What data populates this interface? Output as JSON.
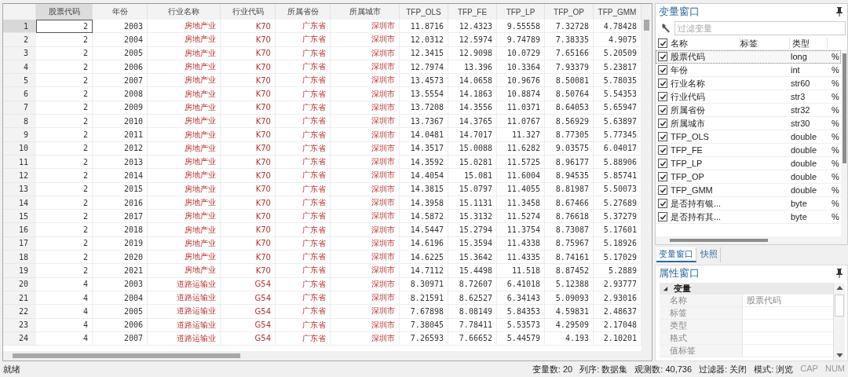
{
  "table": {
    "columns": [
      {
        "label": "股票代码",
        "kind": "numeric"
      },
      {
        "label": "年份",
        "kind": "numeric"
      },
      {
        "label": "行业名称",
        "kind": "string"
      },
      {
        "label": "行业代码",
        "kind": "string"
      },
      {
        "label": "所属省份",
        "kind": "string"
      },
      {
        "label": "所属城市",
        "kind": "string"
      },
      {
        "label": "TFP_OLS",
        "kind": "numeric"
      },
      {
        "label": "TFP_FE",
        "kind": "numeric"
      },
      {
        "label": "TFP_LP",
        "kind": "numeric"
      },
      {
        "label": "TFP_OP",
        "kind": "numeric"
      },
      {
        "label": "TFP_GMM",
        "kind": "numeric"
      }
    ],
    "rows": [
      {
        "number": "1",
        "selected": true,
        "cells": [
          "2",
          "2003",
          "房地产业",
          "K70",
          "广东省",
          "深圳市",
          "11.8716",
          "12.4323",
          "9.55558",
          "7.32728",
          "4.78428"
        ]
      },
      {
        "number": "2",
        "selected": false,
        "cells": [
          "2",
          "2004",
          "房地产业",
          "K70",
          "广东省",
          "深圳市",
          "12.0312",
          "12.5974",
          "9.74789",
          "7.38335",
          "4.9075"
        ]
      },
      {
        "number": "3",
        "selected": false,
        "cells": [
          "2",
          "2005",
          "房地产业",
          "K70",
          "广东省",
          "深圳市",
          "12.3415",
          "12.9098",
          "10.0729",
          "7.65166",
          "5.20509"
        ]
      },
      {
        "number": "4",
        "selected": false,
        "cells": [
          "2",
          "2006",
          "房地产业",
          "K70",
          "广东省",
          "深圳市",
          "12.7974",
          "13.396",
          "10.3364",
          "7.93379",
          "5.23817"
        ]
      },
      {
        "number": "5",
        "selected": false,
        "cells": [
          "2",
          "2007",
          "房地产业",
          "K70",
          "广东省",
          "深圳市",
          "13.4573",
          "14.0658",
          "10.9676",
          "8.50081",
          "5.78035"
        ]
      },
      {
        "number": "6",
        "selected": false,
        "cells": [
          "2",
          "2008",
          "房地产业",
          "K70",
          "广东省",
          "深圳市",
          "13.5554",
          "14.1863",
          "10.8874",
          "8.50764",
          "5.54353"
        ]
      },
      {
        "number": "7",
        "selected": false,
        "cells": [
          "2",
          "2009",
          "房地产业",
          "K70",
          "广东省",
          "深圳市",
          "13.7208",
          "14.3556",
          "11.0371",
          "8.64053",
          "5.65947"
        ]
      },
      {
        "number": "8",
        "selected": false,
        "cells": [
          "2",
          "2010",
          "房地产业",
          "K70",
          "广东省",
          "深圳市",
          "13.7367",
          "14.3765",
          "11.0767",
          "8.56929",
          "5.63897"
        ]
      },
      {
        "number": "9",
        "selected": false,
        "cells": [
          "2",
          "2011",
          "房地产业",
          "K70",
          "广东省",
          "深圳市",
          "14.0481",
          "14.7017",
          "11.327",
          "8.77305",
          "5.77345"
        ]
      },
      {
        "number": "10",
        "selected": false,
        "cells": [
          "2",
          "2012",
          "房地产业",
          "K70",
          "广东省",
          "深圳市",
          "14.3517",
          "15.0088",
          "11.6282",
          "9.03575",
          "6.04017"
        ]
      },
      {
        "number": "11",
        "selected": false,
        "cells": [
          "2",
          "2013",
          "房地产业",
          "K70",
          "广东省",
          "深圳市",
          "14.3592",
          "15.0281",
          "11.5725",
          "8.96177",
          "5.88906"
        ]
      },
      {
        "number": "12",
        "selected": false,
        "cells": [
          "2",
          "2014",
          "房地产业",
          "K70",
          "广东省",
          "深圳市",
          "14.4054",
          "15.081",
          "11.6004",
          "8.94535",
          "5.85741"
        ]
      },
      {
        "number": "13",
        "selected": false,
        "cells": [
          "2",
          "2015",
          "房地产业",
          "K70",
          "广东省",
          "深圳市",
          "14.3815",
          "15.0797",
          "11.4055",
          "8.81987",
          "5.50073"
        ]
      },
      {
        "number": "14",
        "selected": false,
        "cells": [
          "2",
          "2016",
          "房地产业",
          "K70",
          "广东省",
          "深圳市",
          "14.3958",
          "15.1131",
          "11.3458",
          "8.67466",
          "5.27689"
        ]
      },
      {
        "number": "15",
        "selected": false,
        "cells": [
          "2",
          "2017",
          "房地产业",
          "K70",
          "广东省",
          "深圳市",
          "14.5872",
          "15.3132",
          "11.5274",
          "8.76618",
          "5.37279"
        ]
      },
      {
        "number": "16",
        "selected": false,
        "cells": [
          "2",
          "2018",
          "房地产业",
          "K70",
          "广东省",
          "深圳市",
          "14.5447",
          "15.2794",
          "11.3754",
          "8.73087",
          "5.17601"
        ]
      },
      {
        "number": "17",
        "selected": false,
        "cells": [
          "2",
          "2019",
          "房地产业",
          "K70",
          "广东省",
          "深圳市",
          "14.6196",
          "15.3594",
          "11.4338",
          "8.75967",
          "5.18926"
        ]
      },
      {
        "number": "18",
        "selected": false,
        "cells": [
          "2",
          "2020",
          "房地产业",
          "K70",
          "广东省",
          "深圳市",
          "14.6225",
          "15.3642",
          "11.4335",
          "8.74161",
          "5.17029"
        ]
      },
      {
        "number": "19",
        "selected": false,
        "cells": [
          "2",
          "2021",
          "房地产业",
          "K70",
          "广东省",
          "深圳市",
          "14.7112",
          "15.4498",
          "11.518",
          "8.87452",
          "5.2889"
        ]
      },
      {
        "number": "20",
        "selected": false,
        "cells": [
          "4",
          "2003",
          "道路运输业",
          "G54",
          "广东省",
          "深圳市",
          "8.30971",
          "8.72607",
          "6.41018",
          "5.12388",
          "2.93777"
        ]
      },
      {
        "number": "21",
        "selected": false,
        "cells": [
          "4",
          "2004",
          "道路运输业",
          "G54",
          "广东省",
          "深圳市",
          "8.21591",
          "8.62527",
          "6.34143",
          "5.09093",
          "2.93016"
        ]
      },
      {
        "number": "22",
        "selected": false,
        "cells": [
          "4",
          "2005",
          "道路运输业",
          "G54",
          "广东省",
          "深圳市",
          "7.67898",
          "8.08149",
          "5.84353",
          "4.59831",
          "2.48637"
        ]
      },
      {
        "number": "23",
        "selected": false,
        "cells": [
          "4",
          "2006",
          "道路运输业",
          "G54",
          "广东省",
          "深圳市",
          "7.38045",
          "7.78411",
          "5.53573",
          "4.29509",
          "2.17048"
        ]
      },
      {
        "number": "24",
        "selected": false,
        "cells": [
          "4",
          "2007",
          "道路运输业",
          "G54",
          "广东省",
          "深圳市",
          "7.26593",
          "7.66652",
          "5.44579",
          "4.193",
          "2.10201"
        ]
      }
    ]
  },
  "variables_panel": {
    "title": "变量窗口",
    "filter": {
      "placeholder": "过滤变量"
    },
    "all_checked": true,
    "columns": [
      "名称",
      "标签",
      "类型"
    ],
    "variables": [
      {
        "name": "股票代码",
        "type": "long",
        "format": "%",
        "checked": true,
        "selected": true
      },
      {
        "name": "年份",
        "type": "int",
        "format": "%",
        "checked": true,
        "selected": false
      },
      {
        "name": "行业名称",
        "type": "str60",
        "format": "%",
        "checked": true,
        "selected": false
      },
      {
        "name": "行业代码",
        "type": "str3",
        "format": "%",
        "checked": true,
        "selected": false
      },
      {
        "name": "所属省份",
        "type": "str32",
        "format": "%",
        "checked": true,
        "selected": false
      },
      {
        "name": "所属城市",
        "type": "str30",
        "format": "%",
        "checked": true,
        "selected": false
      },
      {
        "name": "TFP_OLS",
        "type": "double",
        "format": "%",
        "checked": true,
        "selected": false
      },
      {
        "name": "TFP_FE",
        "type": "double",
        "format": "%",
        "checked": true,
        "selected": false
      },
      {
        "name": "TFP_LP",
        "type": "double",
        "format": "%",
        "checked": true,
        "selected": false
      },
      {
        "name": "TFP_OP",
        "type": "double",
        "format": "%",
        "checked": true,
        "selected": false
      },
      {
        "name": "TFP_GMM",
        "type": "double",
        "format": "%",
        "checked": true,
        "selected": false
      },
      {
        "name": "是否持有银...",
        "type": "byte",
        "format": "%",
        "checked": true,
        "selected": false
      },
      {
        "name": "是否持有其...",
        "type": "byte",
        "format": "%",
        "checked": true,
        "selected": false
      }
    ]
  },
  "panel_tabs": [
    {
      "label": "变量窗口",
      "selected": true
    },
    {
      "label": "快照",
      "selected": false
    }
  ],
  "properties_panel": {
    "title": "属性窗口",
    "section": {
      "label": "变量",
      "expanded": true
    },
    "rows": [
      {
        "label": "名称",
        "value": "股票代码"
      },
      {
        "label": "标签"
      },
      {
        "label": "类型"
      },
      {
        "label": "格式"
      },
      {
        "label": "值标签"
      }
    ]
  },
  "status_bar": {
    "status": "就绪",
    "items": [
      {
        "text": "变量数: 20"
      },
      {
        "text": "列序: 数据集"
      },
      {
        "text": "观测数: 40,736"
      },
      {
        "text": "过滤器: 关闭"
      },
      {
        "text": "模式: 浏览"
      }
    ],
    "indicators": [
      {
        "text": "CAP",
        "on": false
      },
      {
        "text": "NUM",
        "on": false
      }
    ]
  }
}
